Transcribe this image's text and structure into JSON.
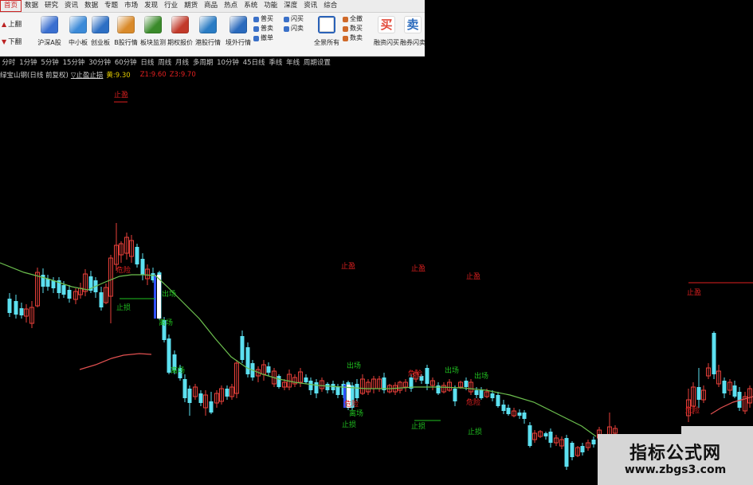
{
  "menu": [
    "首页",
    "数据",
    "研究",
    "资讯",
    "数据",
    "专题",
    "市场",
    "发现",
    "行业",
    "期货",
    "商品",
    "热点",
    "系统",
    "功能",
    "深度",
    "资讯",
    "综合"
  ],
  "page_buttons": {
    "prev": "上翻",
    "next": "下翻"
  },
  "tools": [
    {
      "label": "沪深A股",
      "color": "#3a6fd0"
    },
    {
      "label": "中小板",
      "color": "#3b8ad8"
    },
    {
      "label": "创业板",
      "color": "#2d6fc4"
    },
    {
      "label": "B股行情",
      "color": "#d98a2a"
    },
    {
      "label": "板块监测",
      "color": "#3a8a2a"
    },
    {
      "label": "期权报价",
      "color": "#c23a2a"
    },
    {
      "label": "港股行情",
      "color": "#2a7cc4"
    },
    {
      "label": "境外行情",
      "color": "#2a6abd"
    }
  ],
  "stack1": [
    "普买",
    "普卖",
    "撤单"
  ],
  "stack2": [
    "闪买",
    "闪卖"
  ],
  "tool_all": {
    "label": "全景所有",
    "color": "#2a62b8"
  },
  "stack3": [
    "全撤",
    "数买",
    "数卖"
  ],
  "tool_margin_buy": {
    "label": "融资闪买",
    "char": "买",
    "color": "#e24a3a"
  },
  "tool_margin_sell": {
    "label": "融券闪卖",
    "char": "卖",
    "color": "#2a6abd"
  },
  "periods": [
    "分时",
    "1分钟",
    "5分钟",
    "15分钟",
    "30分钟",
    "60分钟",
    "日线",
    "周线",
    "月线",
    "多周期",
    "10分钟",
    "45日线",
    "季线",
    "年线",
    "周期设置"
  ],
  "info": {
    "stock": "绿宝山钢(日线 前复权)",
    "indicator": "▽止盈止损",
    "yellow": "黄:9.30",
    "z1": "Z1:9.60",
    "z3": "Z3:9.70"
  },
  "signals": [
    {
      "text": "止盈",
      "color": "#e02020"
    },
    {
      "text": "危险",
      "color": "#e02020"
    },
    {
      "text": "止损",
      "color": "#20c020"
    },
    {
      "text": "出场",
      "color": "#20c020"
    },
    {
      "text": "离场",
      "color": "#20c020"
    },
    {
      "text": "止盈",
      "color": "#e02020"
    },
    {
      "text": "止盈",
      "color": "#e02020"
    },
    {
      "text": "止盈",
      "color": "#e02020"
    },
    {
      "text": "出场",
      "color": "#20c020"
    },
    {
      "text": "危险",
      "color": "#e02020"
    },
    {
      "text": "离场",
      "color": "#20c020"
    },
    {
      "text": "止损",
      "color": "#20c020"
    },
    {
      "text": "出场",
      "color": "#20c020"
    },
    {
      "text": "出场",
      "color": "#20c020"
    },
    {
      "text": "危险",
      "color": "#e02020"
    },
    {
      "text": "止损",
      "color": "#20c020"
    },
    {
      "text": "危险",
      "color": "#e02020"
    },
    {
      "text": "止损",
      "color": "#20c020"
    },
    {
      "text": "止盈",
      "color": "#e02020"
    },
    {
      "text": "危险",
      "color": "#e02020"
    },
    {
      "text": "离场",
      "color": "#20c020"
    }
  ],
  "colors": {
    "up": "#e8403a",
    "down": "#5ce0f0",
    "ma_up": "#e05050",
    "ma_down": "#6cbf4e"
  },
  "watermark": {
    "title": "指标公式网",
    "url": "www.zbgs3.com"
  }
}
